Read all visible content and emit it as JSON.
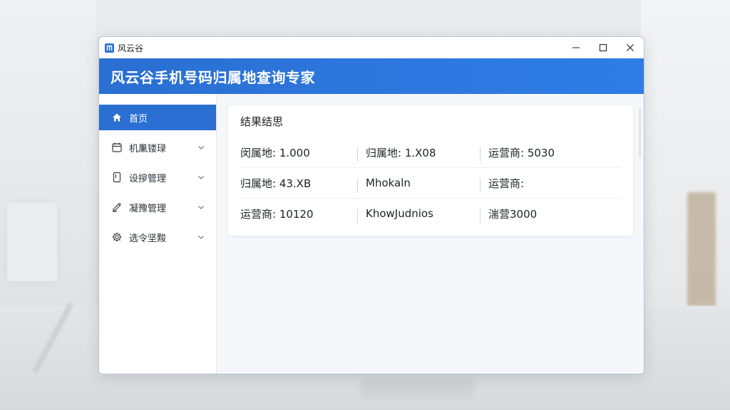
{
  "window": {
    "app_name": "风云谷",
    "controls": {
      "minimize": "minimize",
      "maximize": "maximize",
      "close": "close"
    }
  },
  "banner": {
    "title": "风云谷手机号码归属地查询专家"
  },
  "sidebar": {
    "items": [
      {
        "label": "首页",
        "icon": "home-icon",
        "active": true,
        "expandable": false
      },
      {
        "label": "机凲镂琭",
        "icon": "calendar-icon",
        "active": false,
        "expandable": true
      },
      {
        "label": "设摉管理",
        "icon": "device-icon",
        "active": false,
        "expandable": true
      },
      {
        "label": "凝豫管理",
        "icon": "edit-icon",
        "active": false,
        "expandable": true
      },
      {
        "label": "选令坚黢",
        "icon": "gear-icon",
        "active": false,
        "expandable": true
      }
    ]
  },
  "result": {
    "title": "结果结思",
    "rows": [
      [
        "闵属地: 1.000",
        "归属地: 1.X08",
        "运营商: 5030"
      ],
      [
        "归属地: 43.XB",
        "Mhokaln",
        "运营商:"
      ],
      [
        "运营商: 10120",
        "KhowJudnios",
        "湍营3000"
      ]
    ]
  },
  "colors": {
    "accent": "#2a6fd1",
    "window_bg": "#f5f7fa",
    "card_bg": "#ffffff"
  }
}
